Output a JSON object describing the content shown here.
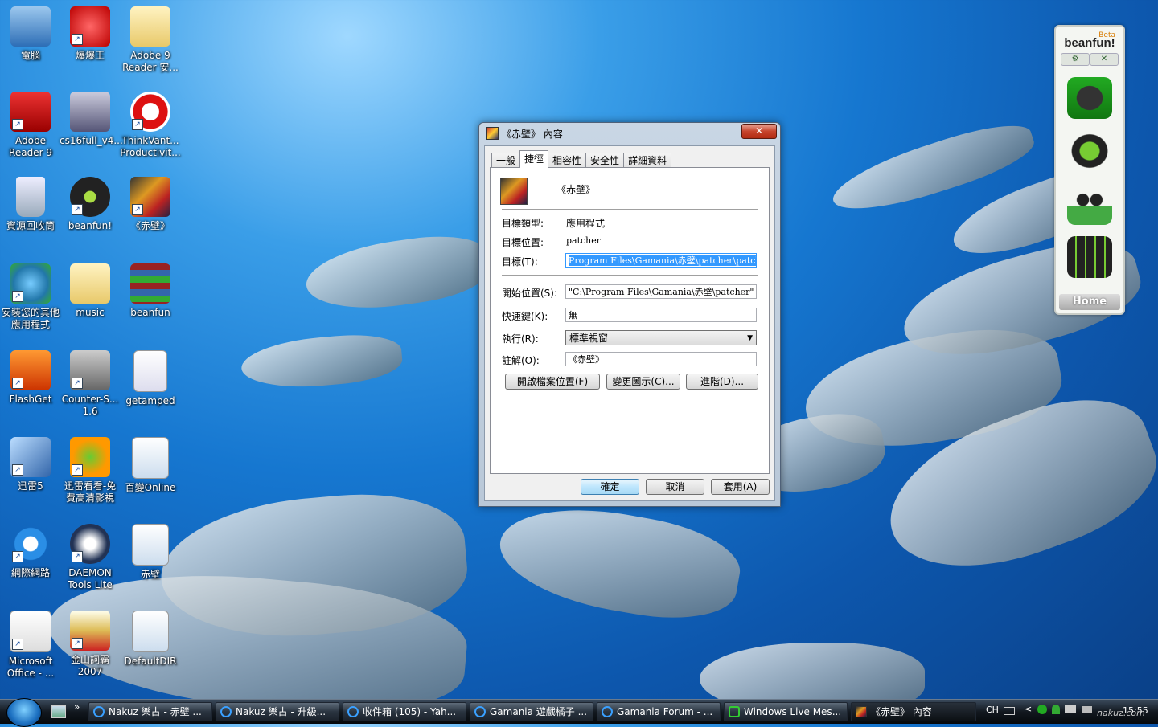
{
  "desktop": {
    "icons": [
      {
        "label": "電腦"
      },
      {
        "label": "爆爆王"
      },
      {
        "label": "Adobe 9 Reader 安..."
      },
      {
        "label": "Adobe Reader 9"
      },
      {
        "label": "cs16full_v4..."
      },
      {
        "label": "ThinkVant... Productivit..."
      },
      {
        "label": "資源回收筒"
      },
      {
        "label": "beanfun!"
      },
      {
        "label": "《赤壁》"
      },
      {
        "label": "安裝您的其他應用程式"
      },
      {
        "label": "music"
      },
      {
        "label": "beanfun"
      },
      {
        "label": "FlashGet"
      },
      {
        "label": "Counter-S... 1.6"
      },
      {
        "label": "getamped"
      },
      {
        "label": "迅雷5"
      },
      {
        "label": "迅雷看看-免費高清影視"
      },
      {
        "label": "百變Online"
      },
      {
        "label": "網際網路"
      },
      {
        "label": "DAEMON Tools Lite"
      },
      {
        "label": "赤壁"
      },
      {
        "label": "Microsoft Office - ..."
      },
      {
        "label": "金山詞霸 2007"
      },
      {
        "label": "DefaultDIR"
      }
    ]
  },
  "beanfun_widget": {
    "logo": "beanfun!",
    "badge": "Beta",
    "settings_glyph": "⚙",
    "close_glyph": "✕",
    "home_label": "Home",
    "icons": [
      "gamepad-icon",
      "g-coin-icon",
      "friends-icon",
      "calendar-icon"
    ]
  },
  "dialog": {
    "title": "《赤壁》 內容",
    "close_label": "✕",
    "tabs": [
      "一般",
      "捷徑",
      "相容性",
      "安全性",
      "詳細資料"
    ],
    "active_tab": "捷徑",
    "app_name": "《赤壁》",
    "target_type_label": "目標類型:",
    "target_type_value": "應用程式",
    "target_location_label": "目標位置:",
    "target_location_value": "patcher",
    "target_label": "目標(T):",
    "target_value": "Program Files\\Gamania\\赤壁\\patcher\\patcher.exe\"",
    "start_in_label": "開始位置(S):",
    "start_in_value": "\"C:\\Program Files\\Gamania\\赤壁\\patcher\"",
    "hotkey_label": "快速鍵(K):",
    "hotkey_value": "無",
    "run_label": "執行(R):",
    "run_value": "標準視窗",
    "comment_label": "註解(O):",
    "comment_value": "《赤壁》",
    "open_location_button": "開啟檔案位置(F)",
    "change_icon_button": "變更圖示(C)...",
    "advanced_button": "進階(D)...",
    "ok_button": "確定",
    "cancel_button": "取消",
    "apply_button": "套用(A)"
  },
  "taskbar": {
    "quicklaunch_more": "»",
    "buttons": [
      {
        "label": "Nakuz 樂古 - 赤壁 ..."
      },
      {
        "label": "Nakuz 樂古 - 升級..."
      },
      {
        "label": "收件箱 (105) - Yah..."
      },
      {
        "label": "Gamania 遊戲橘子 ..."
      },
      {
        "label": "Gamania Forum - ..."
      },
      {
        "label": "Windows Live Mes..."
      },
      {
        "label": "《赤壁》 內容"
      }
    ],
    "tray": {
      "language": "CH",
      "chevron": "<",
      "clock": "15:55",
      "watermark": "nakuz.com"
    }
  }
}
